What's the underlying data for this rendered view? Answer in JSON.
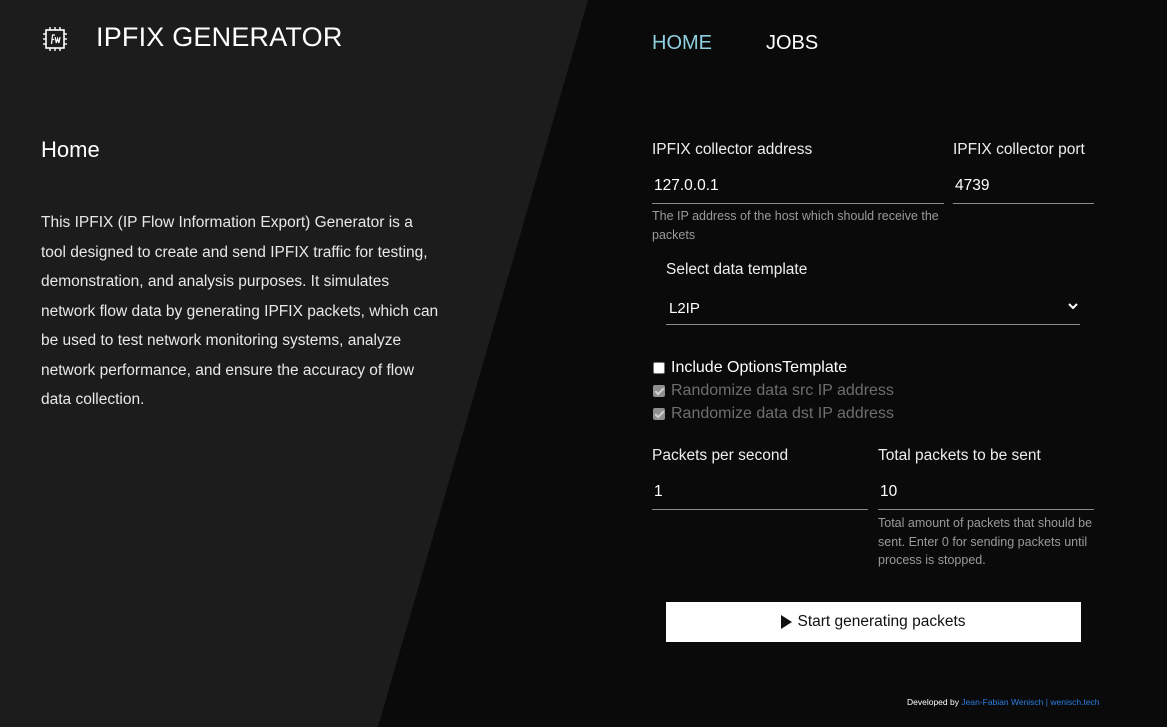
{
  "header": {
    "title": "IPFIX GENERATOR",
    "logo_icon": "fw-chip-icon"
  },
  "nav": {
    "home": "HOME",
    "jobs": "JOBS",
    "active_color": "#8ecfe0"
  },
  "home": {
    "heading": "Home",
    "description": "This IPFIX (IP Flow Information Export) Generator is a tool designed to create and send IPFIX traffic for testing, demonstration, and analysis purposes. It simulates network flow data by generating IPFIX packets, which can be used to test network monitoring systems, analyze network performance, and ensure the accuracy of flow data collection."
  },
  "form": {
    "collector_address": {
      "label": "IPFIX collector address",
      "value": "127.0.0.1",
      "hint": "The IP address of the host which should receive the packets"
    },
    "collector_port": {
      "label": "IPFIX collector port",
      "value": "4739"
    },
    "template": {
      "label": "Select data template",
      "selected": "L2IP"
    },
    "checkboxes": {
      "options_template": {
        "label": "Include OptionsTemplate",
        "checked": false,
        "disabled": false
      },
      "randomize_src": {
        "label": "Randomize data src IP address",
        "checked": true,
        "disabled": true
      },
      "randomize_dst": {
        "label": "Randomize data dst IP address",
        "checked": true,
        "disabled": true
      }
    },
    "packets_per_second": {
      "label": "Packets per second",
      "value": "1"
    },
    "total_packets": {
      "label": "Total packets to be sent",
      "value": "10",
      "hint": "Total amount of packets that should be sent. Enter 0 for sending packets until process is stopped."
    },
    "start_button": "Start generating packets"
  },
  "footer": {
    "prefix": "Developed by",
    "author": "Jean-Fabian Wenisch",
    "separator": "|",
    "site": "wenisch.tech",
    "link_color": "#2a7de1"
  }
}
